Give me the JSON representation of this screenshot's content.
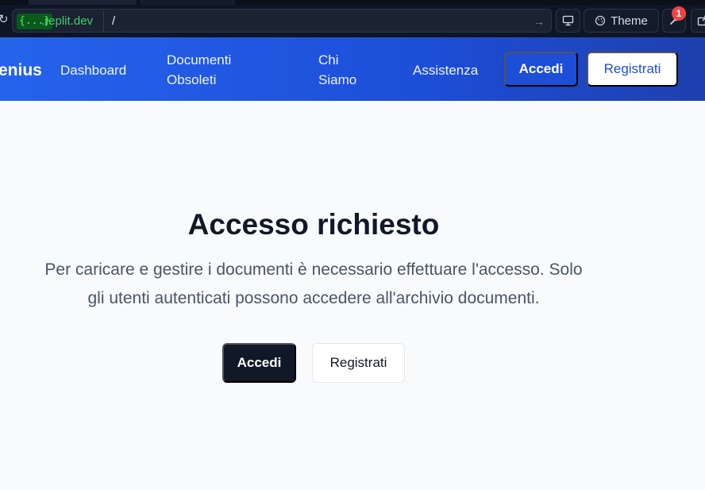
{
  "browser": {
    "url_chip": "{...}",
    "url_domain": ".replit.dev",
    "url_path": "/",
    "theme_label": "Theme",
    "notification_count": "1"
  },
  "header": {
    "logo": "enius",
    "nav": {
      "dashboard": "Dashboard",
      "documenti_line1": "Documenti",
      "documenti_line2": "Obsoleti",
      "chisiamo_line1": "Chi",
      "chisiamo_line2": "Siamo",
      "assistenza": "Assistenza"
    },
    "accedi_label": "Accedi",
    "registrati_label": "Registrati"
  },
  "main": {
    "title": "Accesso richiesto",
    "desc_line1": "Per caricare e gestire i documenti è necessario effettuare l'accesso. Solo",
    "desc_line2": "gli utenti autenticati possono accedere all'archivio documenti.",
    "accedi_label": "Accedi",
    "registrati_label": "Registrati"
  },
  "colors": {
    "header_gradient_start": "#2563eb",
    "header_gradient_end": "#1e40af",
    "primary_dark": "#111827",
    "badge_red": "#ef4444"
  }
}
